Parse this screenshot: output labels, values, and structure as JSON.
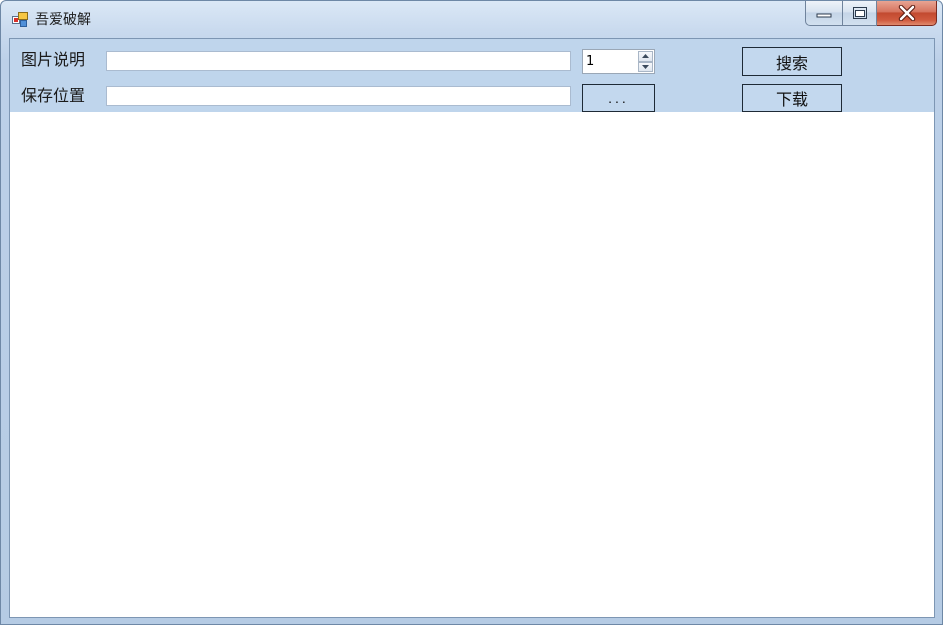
{
  "window": {
    "title": "吾爱破解",
    "icons": {
      "app": "app-window-icon",
      "minimize": "minimize-icon",
      "maximize": "maximize-icon",
      "close": "close-icon"
    }
  },
  "form": {
    "description_label": "图片说明",
    "description_value": "",
    "count_value": "1",
    "save_label": "保存位置",
    "save_path_value": "",
    "browse_label": "...",
    "search_label": "搜索",
    "download_label": "下载"
  }
}
